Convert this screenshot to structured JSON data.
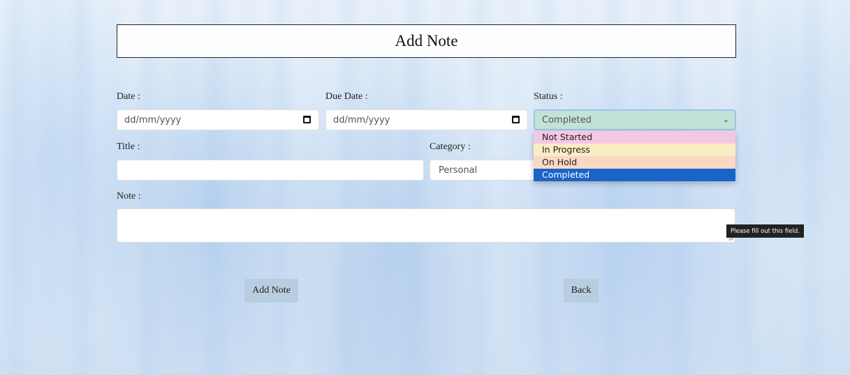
{
  "header": {
    "title": "Add Note"
  },
  "form": {
    "date": {
      "label": "Date :",
      "placeholder": "dd/mm/yyyy"
    },
    "due_date": {
      "label": "Due Date :",
      "placeholder": "dd/mm/yyyy"
    },
    "status": {
      "label": "Status :",
      "selected": "Completed",
      "options": [
        "Not Started",
        "In Progress",
        "On Hold",
        "Completed"
      ]
    },
    "title": {
      "label": "Title :",
      "value": ""
    },
    "category": {
      "label": "Category :",
      "selected": "Personal"
    },
    "note": {
      "label": "Note :",
      "value": ""
    }
  },
  "tooltip": {
    "text": "Please fill out this field."
  },
  "buttons": {
    "add_note": "Add Note",
    "back": "Back"
  },
  "colors": {
    "status_selected_bg": "#c3e3d7",
    "not_started": "#f4c7e3",
    "in_progress": "#faedc4",
    "on_hold": "#f9d9c4",
    "completed_highlight": "#1864c8",
    "button_bg": "#b8cde0"
  }
}
